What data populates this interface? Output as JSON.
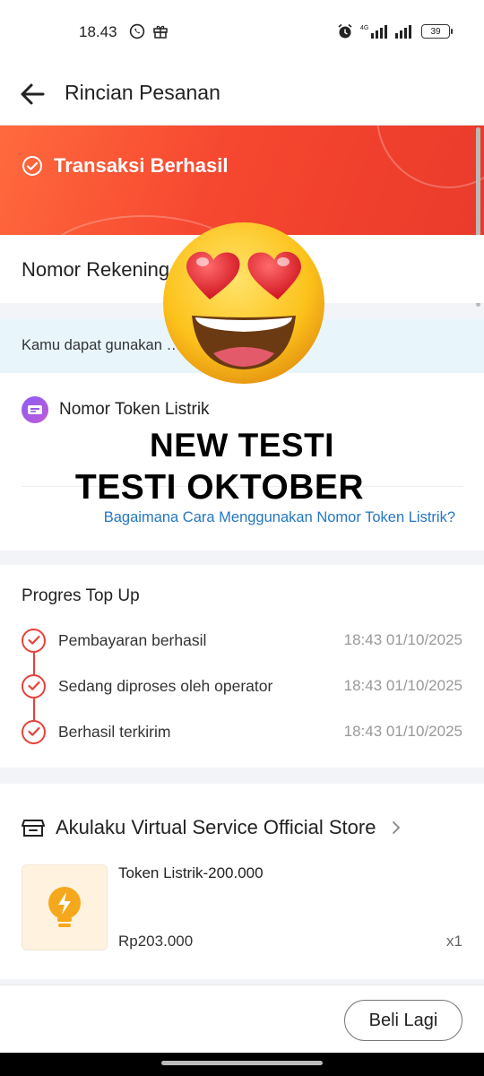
{
  "status_bar": {
    "time": "18.43",
    "network": "4G",
    "battery": "39",
    "icons": [
      "whatsapp-icon",
      "gift-icon",
      "alarm-icon",
      "signal-icon",
      "signal-icon",
      "battery-icon"
    ]
  },
  "header": {
    "title": "Rincian Pesanan",
    "back_icon": "arrow-left-icon"
  },
  "hero": {
    "status": "Transaksi Berhasil",
    "status_icon": "check-circle-icon"
  },
  "account": {
    "label": "Nomor Rekening … 3"
  },
  "info_banner": {
    "text": "Kamu dapat gunakan … rik di bawah ini"
  },
  "token": {
    "title": "Nomor Token Listrik",
    "help_link": "Bagaimana Cara Menggunakan Nomor Token Listrik?"
  },
  "overlay": {
    "line1": "NEW TESTI",
    "line2": "TESTI OKTOBER",
    "emoji": "heart-eyes-emoji"
  },
  "progress": {
    "title": "Progres Top Up",
    "steps": [
      {
        "label": "Pembayaran berhasil",
        "time": "18:43 01/10/2025"
      },
      {
        "label": "Sedang diproses oleh operator",
        "time": "18:43 01/10/2025"
      },
      {
        "label": "Berhasil terkirim",
        "time": "18:43 01/10/2025"
      }
    ]
  },
  "store": {
    "name": "Akulaku Virtual Service Official Store",
    "product": {
      "name": "Token Listrik-200.000",
      "price": "Rp203.000",
      "qty": "x1"
    }
  },
  "footer": {
    "buy_again": "Beli Lagi"
  },
  "colors": {
    "accent": "#f64730",
    "link": "#2577c4",
    "banner": "#e8f6fc"
  }
}
